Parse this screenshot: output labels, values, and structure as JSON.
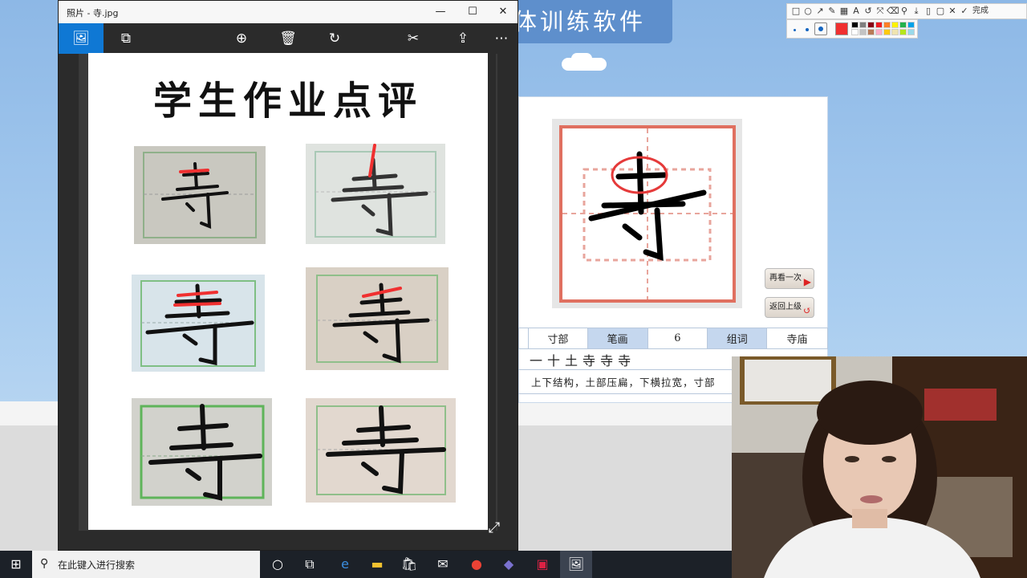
{
  "background_app": {
    "title": "体训练软件",
    "buttons": {
      "replay": "再看一次",
      "back": "返回上级"
    },
    "info": {
      "radical": "寸部",
      "stroke_count_label": "笔画",
      "stroke_count": "6",
      "words_label": "组词",
      "words": "寺庙",
      "stroke_order": [
        "一",
        "十",
        "土",
        "寺",
        "寺",
        "寺"
      ],
      "structure": "上下结构，土部压扁，下横拉宽，寸部"
    },
    "character": "寺"
  },
  "annotation_toolbar": {
    "tools": [
      "square-icon",
      "circle-icon",
      "arrow-icon",
      "pen-icon",
      "mosaic-icon",
      "text-icon",
      "undo-icon",
      "redo-icon",
      "pin-icon",
      "save-icon",
      "copy-icon",
      "bookmark-icon",
      "close-icon",
      "confirm-icon"
    ],
    "done_label": "完成",
    "palette": [
      "#000000",
      "#7f7f7f",
      "#880015",
      "#ed1c24",
      "#ff7f27",
      "#fff200",
      "#22b14c",
      "#00a2e8",
      "#ffffff",
      "#c3c3c3",
      "#b97a57",
      "#ffaec9",
      "#ffc90e",
      "#efe4b0",
      "#b5e61d",
      "#99d9ea"
    ],
    "current_color": "#f03030"
  },
  "photos_window": {
    "title": "照片 - 寺.jpg",
    "window_controls": {
      "minimize": "—",
      "maximize": "☐",
      "close": "✕"
    },
    "document_title": "学生作业点评"
  },
  "taskbar": {
    "search_placeholder": "在此键入进行搜索"
  },
  "colors": {
    "accent": "#0f78d4",
    "app_blue": "#5e8fcc",
    "grid_red": "#e07060"
  }
}
